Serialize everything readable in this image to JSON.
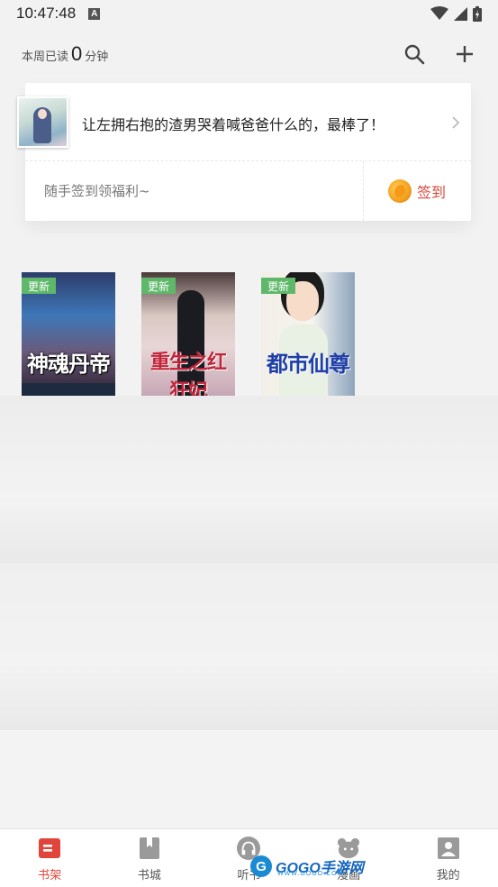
{
  "status_bar": {
    "time": "10:47:48",
    "notification_letter": "A"
  },
  "header": {
    "read_prefix": "本周已读",
    "read_minutes": "0",
    "read_suffix": "分钟",
    "search_icon": "search-icon",
    "add_icon": "plus-icon"
  },
  "recommend_card": {
    "title": "让左拥右抱的渣男哭着喊爸爸什么的，最棒了！",
    "welfare_text": "随手签到领福利~",
    "signin_label": "签到"
  },
  "books": [
    {
      "tag": "更新",
      "title": "神魂丹帝"
    },
    {
      "tag": "更新",
      "title": "重生之红狂妃"
    },
    {
      "tag": "更新",
      "title": "都市仙尊"
    }
  ],
  "tabs": [
    {
      "label": "书架",
      "icon": "bookshelf-icon",
      "active": true
    },
    {
      "label": "书城",
      "icon": "bookmark-book-icon",
      "active": false
    },
    {
      "label": "听书",
      "icon": "headphones-icon",
      "active": false
    },
    {
      "label": "漫画",
      "icon": "bear-icon",
      "active": false
    },
    {
      "label": "我的",
      "icon": "profile-icon",
      "active": false
    }
  ],
  "watermark": {
    "logo": "G",
    "text_a": "GOGO",
    "text_b": "手游网",
    "sub": "WWW.GOGO.COM"
  },
  "colors": {
    "accent": "#e1443a",
    "tag_green": "#5fb86a",
    "signin_red": "#d94a3d"
  }
}
